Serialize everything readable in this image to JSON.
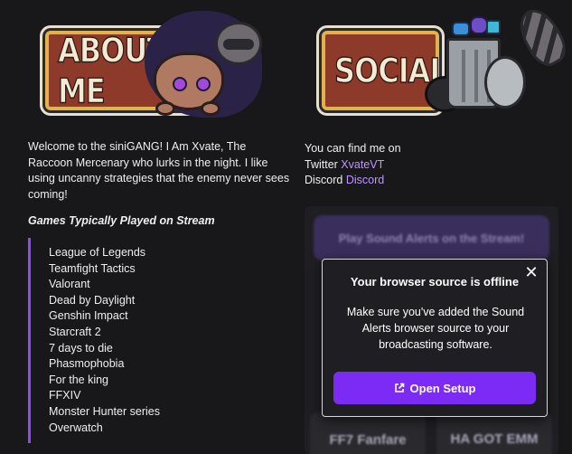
{
  "panels": {
    "about_title": "ABOUT ME",
    "socials_title": "SOCIALS"
  },
  "about": {
    "intro": "Welcome to the siniGANG! I Am Xvate, The Raccoon Mercenary who lurks in the night. I like using uncanny strategies that the enemy never sees coming!",
    "games_heading": "Games Typically Played on Stream",
    "games": [
      "League of Legends",
      "Teamfight Tactics",
      "Valorant",
      "Dead by Daylight",
      "Genshin Impact",
      "Starcraft 2",
      "7 days to die",
      "Phasmophobia",
      "For the king",
      "FFXIV",
      "Monster Hunter series",
      "Overwatch"
    ]
  },
  "socials": {
    "intro": "You can find me on",
    "twitter_label": "Twitter",
    "twitter_link": "XvateVT",
    "discord_label": "Discord",
    "discord_link": "Discord"
  },
  "sound_alerts": {
    "title": "Play Sound Alerts on the Stream!",
    "cards": [
      "FF7 Fanfare",
      "HA GOT EMM"
    ],
    "modal": {
      "heading": "Your browser source is offline",
      "body": "Make sure you've added the Sound Alerts browser source to your broadcasting software.",
      "button_label": "Open Setup",
      "close_glyph": "✕"
    }
  },
  "colors": {
    "background": "#18181b",
    "accent": "#9147ff",
    "link": "#bf94ff",
    "button": "#7b2bf4",
    "banner_red": "#8e3a2b",
    "banner_gold": "#e2b34c"
  },
  "icons": [
    "close-icon",
    "external-link-icon"
  ]
}
